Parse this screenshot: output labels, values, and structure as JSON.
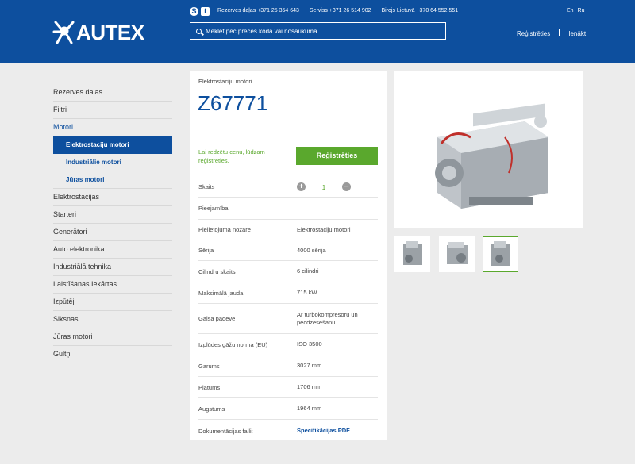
{
  "header": {
    "logo_text": "AUTEX",
    "social": [
      {
        "icon": "skype-icon",
        "glyph": "S"
      },
      {
        "icon": "facebook-icon",
        "glyph": "f"
      }
    ],
    "contacts": [
      "Rezerves daļas +371 25 354 643",
      "Serviss +371 26 514 902",
      "Birojs Lietuvā +370 64 552 551"
    ],
    "languages": [
      "En",
      "Ru"
    ],
    "search_placeholder": "Meklēt pēc preces koda vai nosaukuma",
    "register": "Reģistrēties",
    "login": "Ienākt"
  },
  "sidebar": {
    "items": [
      {
        "label": "Rezerves daļas"
      },
      {
        "label": "Filtri"
      },
      {
        "label": "Motori",
        "active": true
      },
      {
        "label": "Elektrostaciju motori",
        "sub": true,
        "selected": true
      },
      {
        "label": "Industriālie motori",
        "sub": true
      },
      {
        "label": "Jūras motori",
        "sub": true
      },
      {
        "label": "Elektrostacijas"
      },
      {
        "label": "Starteri"
      },
      {
        "label": "Ģenerātori"
      },
      {
        "label": "Auto elektronika"
      },
      {
        "label": "Industriālā tehnika"
      },
      {
        "label": "Laistīšanas Iekārtas"
      },
      {
        "label": "Izpūtēji"
      },
      {
        "label": "Siksnas"
      },
      {
        "label": "Jūras motori"
      },
      {
        "label": "Gultņi"
      }
    ]
  },
  "product": {
    "category": "Elektrostaciju motori",
    "code": "Z67771",
    "price_note": "Lai redzētu cenu, lūdzam reģistrēties.",
    "register_button": "Reģistrēties",
    "quantity_label": "Skaits",
    "quantity": "1",
    "quantity_plus": "+",
    "quantity_minus": "−",
    "specs": [
      {
        "k": "Pieejamība",
        "v": ""
      },
      {
        "k": "Pielietojuma nozare",
        "v": "Elektrostaciju motori"
      },
      {
        "k": "Sērija",
        "v": "4000 sērija"
      },
      {
        "k": "Cilindru skaits",
        "v": "6 cilindri"
      },
      {
        "k": "Maksimālā jauda",
        "v": "715 kW"
      },
      {
        "k": "Gaisa padeve",
        "v": "Ar turbokompresoru un pēcdzesēšanu"
      },
      {
        "k": "Izplūdes gāžu norma (EU)",
        "v": "ISO 3500"
      },
      {
        "k": "Garums",
        "v": "3027 mm"
      },
      {
        "k": "Platums",
        "v": "1706 mm"
      },
      {
        "k": "Augstums",
        "v": "1964 mm"
      }
    ],
    "docs_label": "Dokumentācijas faili:",
    "docs_link": "Specifikācijas PDF"
  },
  "colors": {
    "brand": "#0d4f9e",
    "accent": "#5aa82d"
  }
}
